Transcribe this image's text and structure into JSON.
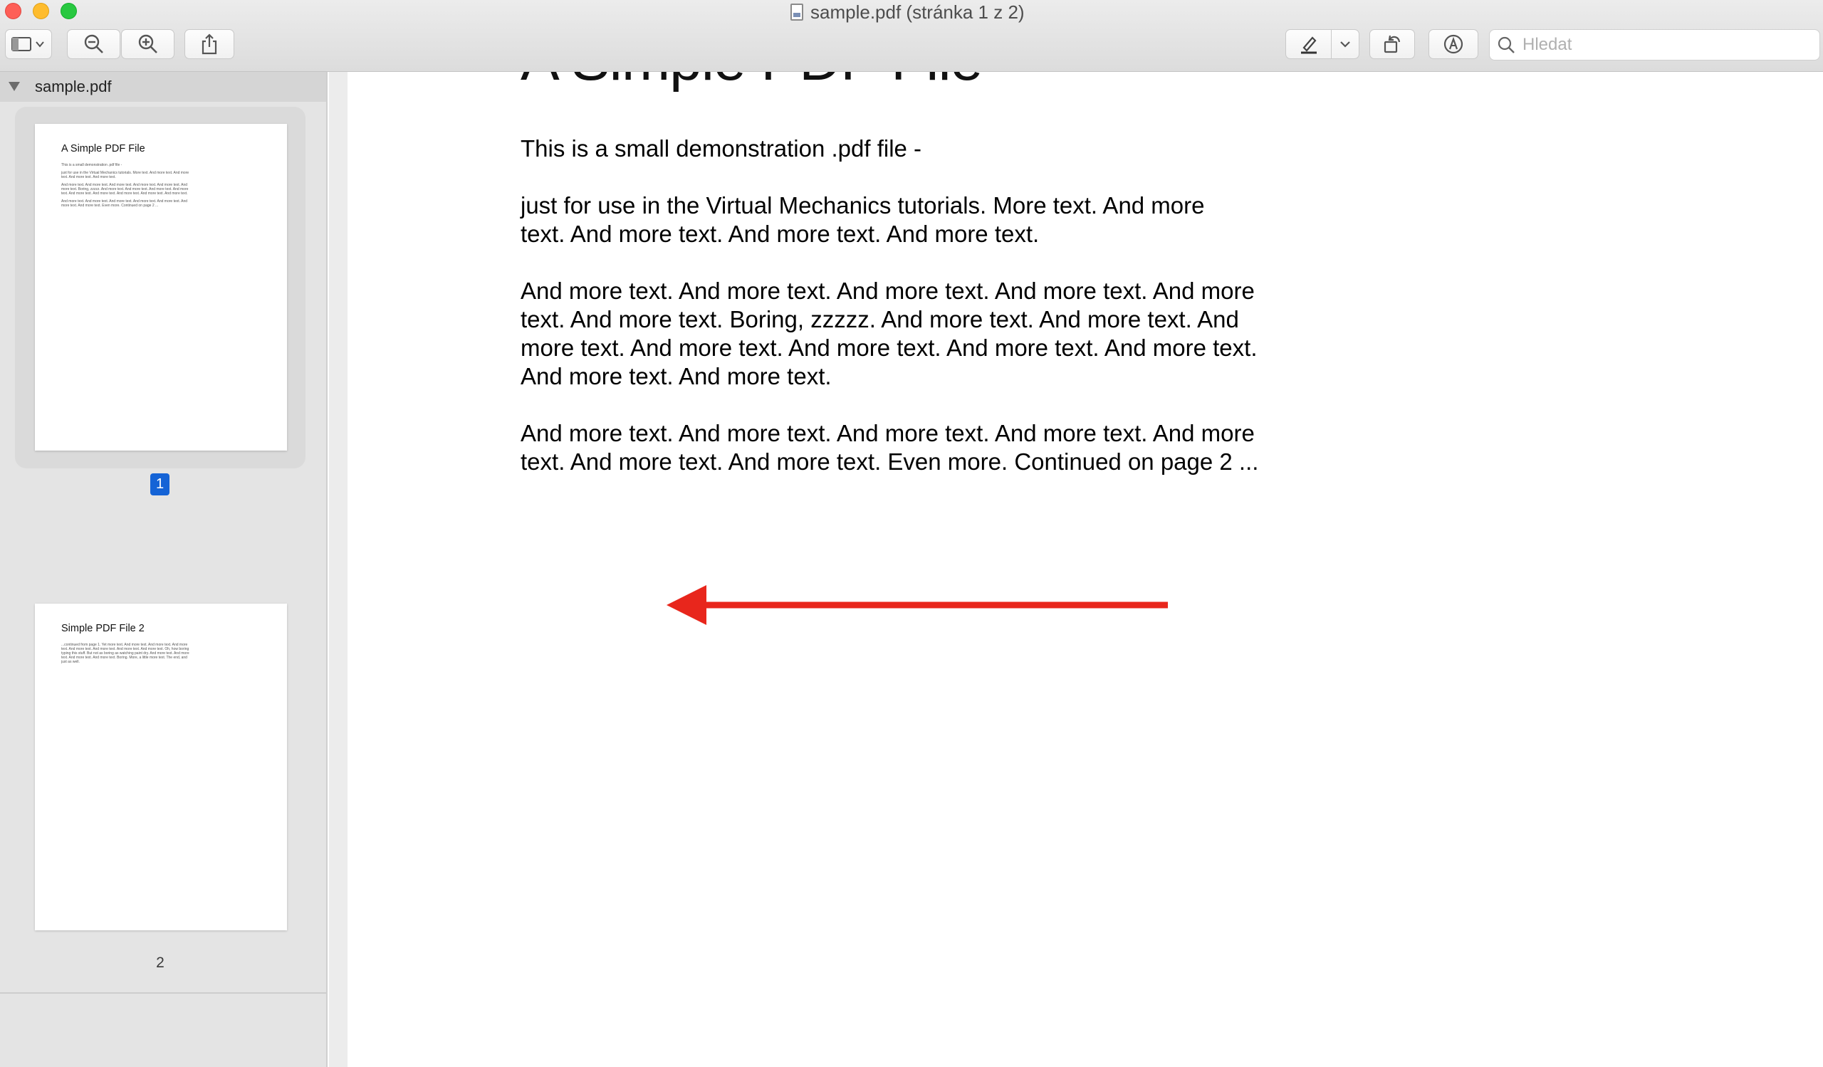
{
  "window": {
    "title": "sample.pdf (stránka 1 z 2)"
  },
  "toolbar": {
    "sidebar_toggle_icon": "sidebar-icon",
    "zoom_out_icon": "zoom-out-icon",
    "zoom_in_icon": "zoom-in-icon",
    "share_icon": "share-icon",
    "highlight_icon": "highlighter-icon",
    "rotate_icon": "rotate-icon",
    "markup_icon": "markup-icon",
    "search_placeholder": "Hledat"
  },
  "sidebar": {
    "file_name": "sample.pdf",
    "pages": [
      {
        "number": "1",
        "thumb_title": "A Simple PDF File",
        "thumb_lines": [
          "This is a small demonstration .pdf file -",
          "just for use in the Virtual Mechanics tutorials. More text. And more text. And more text. And more text. And more text.",
          "And more text. And more text. And more text. And more text. And more text. And more text. Boring, zzzzz. And more text. And more text. And more text. And more text. And more text. And more text. And more text. And more text. And more text.",
          "And more text. And more text. And more text. And more text. And more text. And more text. And more text. Even more. Continued on page 2 ..."
        ]
      },
      {
        "number": "2",
        "thumb_title": "Simple PDF File 2",
        "thumb_lines": [
          "...continued from page 1. Yet more text. And more text. And more text. And more text. And more text. And more text. And more text. And more text. Oh, how boring typing this stuff. But not as boring as watching paint dry. And more text. And more text. And more text. And more text. Boring. More, a little more text. The end, and just as well."
        ]
      }
    ]
  },
  "document": {
    "heading_partial": "A Simple PDF File",
    "paragraphs": [
      "This is a small demonstration .pdf file -",
      "just for use in the Virtual Mechanics tutorials. More text. And more\ntext. And more text. And more text. And more text.",
      "And more text. And more text. And more text. And more text. And more\ntext. And more text. Boring, zzzzz. And more text. And more text. And\nmore text. And more text. And more text. And more text. And more text.\nAnd more text. And more text.",
      "And more text. And more text. And more text. And more text. And more\ntext. And more text. And more text. Even more. Continued on page 2 ..."
    ]
  },
  "annotation": {
    "arrow_color": "#e8261c"
  },
  "colors": {
    "selection_badge": "#1463d6"
  }
}
